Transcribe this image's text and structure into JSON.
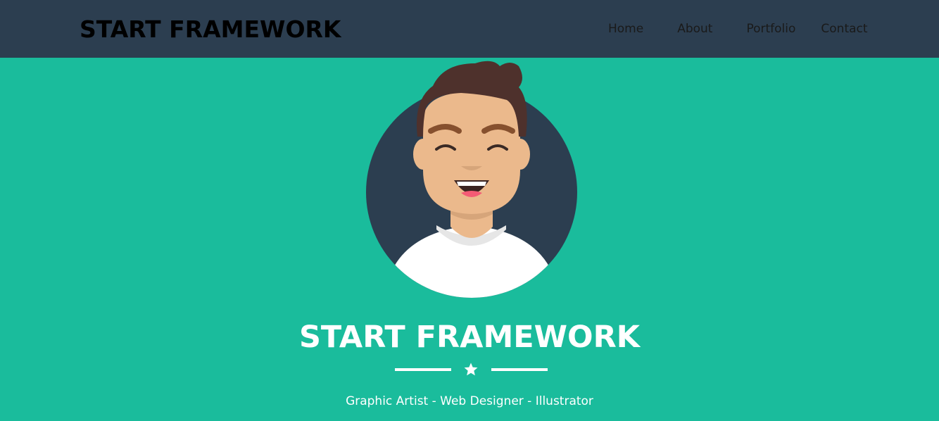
{
  "navbar": {
    "brand": "START FRAMEWORK",
    "links": [
      "Home",
      "About",
      "Portfolio",
      "Contact"
    ]
  },
  "hero": {
    "avatar_icon": "smiling-person-avatar-icon",
    "title": "START FRAMEWORK",
    "divider_icon": "star-icon",
    "subtitle": "Graphic Artist - Web Designer - Illustrator"
  },
  "colors": {
    "navbar_bg": "#2c3e50",
    "hero_bg": "#1abc9c",
    "text_light": "#ffffff",
    "brand_text": "#000000"
  }
}
